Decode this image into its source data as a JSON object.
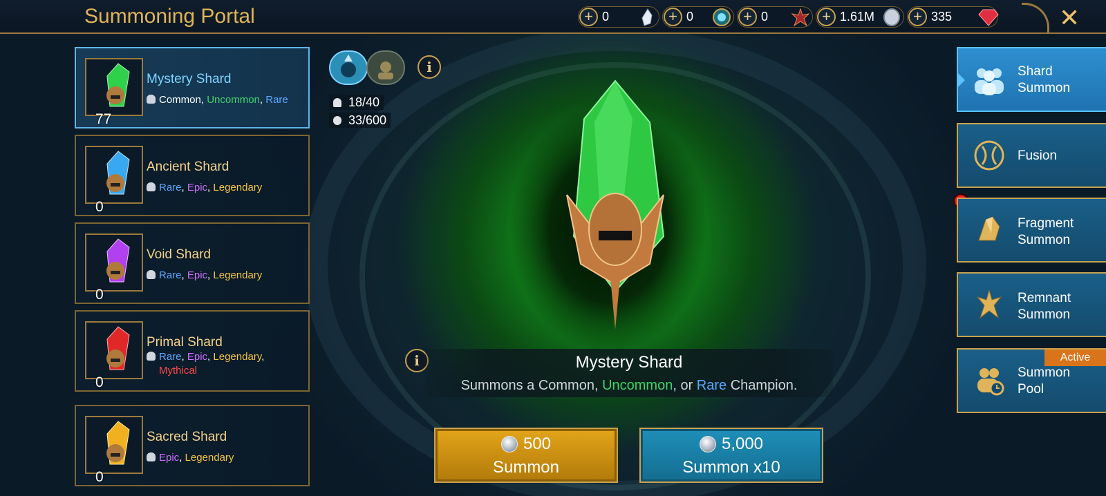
{
  "header": {
    "title": "Summoning Portal",
    "close_icon": "close-icon"
  },
  "resources": [
    {
      "value": "0",
      "icon": "raw-crystal-icon"
    },
    {
      "value": "0",
      "icon": "tome-icon"
    },
    {
      "value": "0",
      "icon": "demon-crest-icon"
    },
    {
      "value": "1.61M",
      "icon": "silver-coin-icon"
    },
    {
      "value": "335",
      "icon": "gem-icon"
    }
  ],
  "shards": [
    {
      "name": "Mystery Shard",
      "count": "77",
      "color": "#2fd14a",
      "rarities": [
        {
          "text": "Common",
          "cls": "common"
        },
        {
          "text": "Uncommon",
          "cls": "unc"
        },
        {
          "text": "Rare",
          "cls": "rare"
        }
      ]
    },
    {
      "name": "Ancient Shard",
      "count": "0",
      "color": "#3aa8f0",
      "rarities": [
        {
          "text": "Rare",
          "cls": "rare"
        },
        {
          "text": "Epic",
          "cls": "epic"
        },
        {
          "text": "Legendary",
          "cls": "leg"
        }
      ]
    },
    {
      "name": "Void Shard",
      "count": "0",
      "color": "#b040f0",
      "rarities": [
        {
          "text": "Rare",
          "cls": "rare"
        },
        {
          "text": "Epic",
          "cls": "epic"
        },
        {
          "text": "Legendary",
          "cls": "leg"
        }
      ]
    },
    {
      "name": "Primal Shard",
      "count": "0",
      "color": "#e02828",
      "rarities": [
        {
          "text": "Rare",
          "cls": "rare"
        },
        {
          "text": "Epic",
          "cls": "epic"
        },
        {
          "text": "Legendary",
          "cls": "leg"
        },
        {
          "text": "Mythical",
          "cls": "myth"
        }
      ]
    },
    {
      "name": "Sacred Shard",
      "count": "0",
      "color": "#f0b020",
      "rarities": [
        {
          "text": "Epic",
          "cls": "epic"
        },
        {
          "text": "Legendary",
          "cls": "leg"
        }
      ]
    }
  ],
  "stats": {
    "champions": "18/40",
    "roster": "33/600"
  },
  "selected": {
    "title": "Mystery Shard",
    "desc_prefix": "Summons a Common, ",
    "desc_uncommon": "Uncommon",
    "desc_mid": ", or ",
    "desc_rare": "Rare",
    "desc_suffix": " Champion."
  },
  "buttons": {
    "summon": {
      "cost": "500",
      "label": "Summon"
    },
    "summon10": {
      "cost": "5,000",
      "label": "Summon x10"
    }
  },
  "tabs": [
    {
      "label_lines": [
        "Shard",
        "Summon"
      ],
      "icon": "group-icon"
    },
    {
      "label_lines": [
        "Fusion"
      ],
      "icon": "fusion-icon"
    },
    {
      "label_lines": [
        "Fragment",
        "Summon"
      ],
      "icon": "fragment-icon"
    },
    {
      "label_lines": [
        "Remnant",
        "Summon"
      ],
      "icon": "remnant-icon"
    },
    {
      "label_lines": [
        "Summon",
        "Pool"
      ],
      "icon": "summon-pool-icon"
    }
  ],
  "active_badge": "Active",
  "colors": {
    "accent_gold": "#c9a24f",
    "title_gold": "#e0b45a",
    "active_tab": "#2e8fd0"
  }
}
